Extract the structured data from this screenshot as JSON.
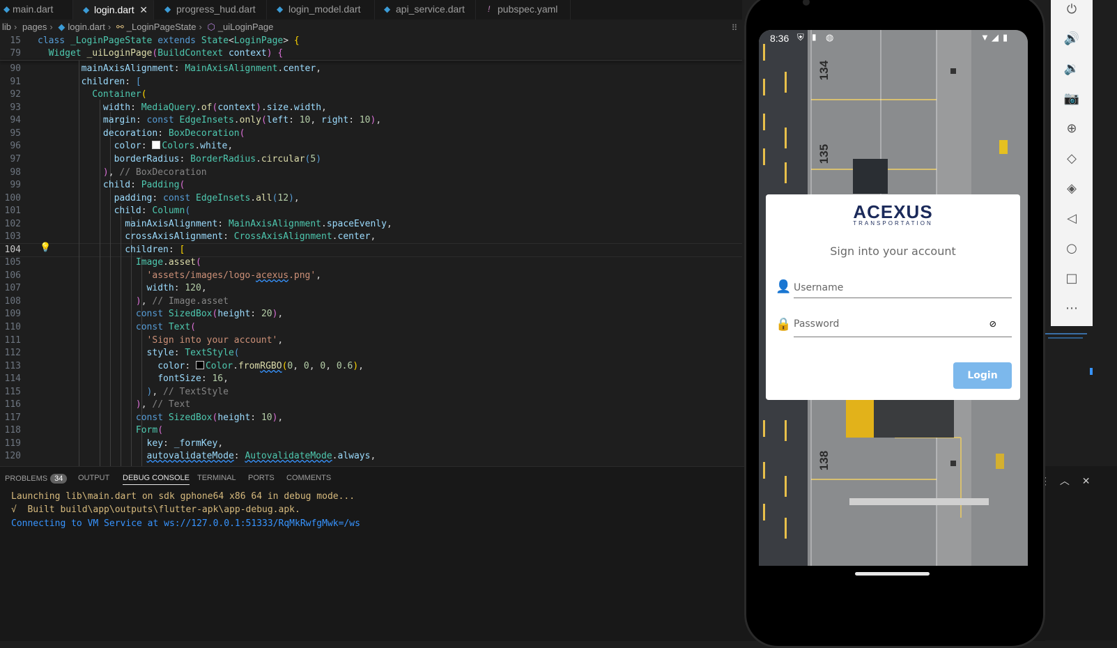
{
  "tabs": [
    {
      "label": "main.dart",
      "active": false
    },
    {
      "label": "login.dart",
      "active": true
    },
    {
      "label": "progress_hud.dart",
      "active": false
    },
    {
      "label": "login_model.dart",
      "active": false
    },
    {
      "label": "api_service.dart",
      "active": false
    },
    {
      "label": "pubspec.yaml",
      "active": false
    }
  ],
  "breadcrumb": [
    "lib",
    "pages",
    "login.dart",
    "_LoginPageState",
    "_uiLoginPage"
  ],
  "editor": {
    "current_line": "104",
    "lines": [
      {
        "n": "15"
      },
      {
        "n": "79"
      },
      {
        "n": "90"
      },
      {
        "n": "91"
      },
      {
        "n": "92"
      },
      {
        "n": "93"
      },
      {
        "n": "94"
      },
      {
        "n": "95"
      },
      {
        "n": "96"
      },
      {
        "n": "97"
      },
      {
        "n": "98"
      },
      {
        "n": "99"
      },
      {
        "n": "100"
      },
      {
        "n": "101"
      },
      {
        "n": "102"
      },
      {
        "n": "103"
      },
      {
        "n": "104"
      },
      {
        "n": "105"
      },
      {
        "n": "106"
      },
      {
        "n": "107"
      },
      {
        "n": "108"
      },
      {
        "n": "109"
      },
      {
        "n": "110"
      },
      {
        "n": "111"
      },
      {
        "n": "112"
      },
      {
        "n": "113"
      },
      {
        "n": "114"
      },
      {
        "n": "115"
      },
      {
        "n": "116"
      },
      {
        "n": "117"
      },
      {
        "n": "118"
      },
      {
        "n": "119"
      },
      {
        "n": "120"
      }
    ]
  },
  "panel": {
    "tabs": [
      {
        "label": "PROBLEMS",
        "badge": "34"
      },
      {
        "label": "OUTPUT"
      },
      {
        "label": "DEBUG CONSOLE",
        "active": true
      },
      {
        "label": "TERMINAL"
      },
      {
        "label": "PORTS"
      },
      {
        "label": "COMMENTS"
      }
    ],
    "console": [
      "Launching lib\\main.dart on sdk gphone64 x86 64 in debug mode...",
      "√  Built build\\app\\outputs\\flutter-apk\\app-debug.apk.",
      "Connecting to VM Service at ws://127.0.0.1:51333/RqMkRwfgMwk=/ws"
    ]
  },
  "phone": {
    "status_time": "8:36",
    "logo_text": "ACEXUS",
    "logo_sub": "TRANSPORTATION",
    "title": "Sign into your account",
    "username_placeholder": "Username",
    "password_placeholder": "Password",
    "login_label": "Login",
    "lot_numbers": [
      "134",
      "135",
      "138"
    ]
  },
  "colors": {
    "editor_bg": "#1e1e1e",
    "login_button": "#7cb8ec",
    "brand_navy": "#1b2a5a",
    "console_yellow": "#d7ba7d",
    "console_blue": "#3794ff"
  }
}
